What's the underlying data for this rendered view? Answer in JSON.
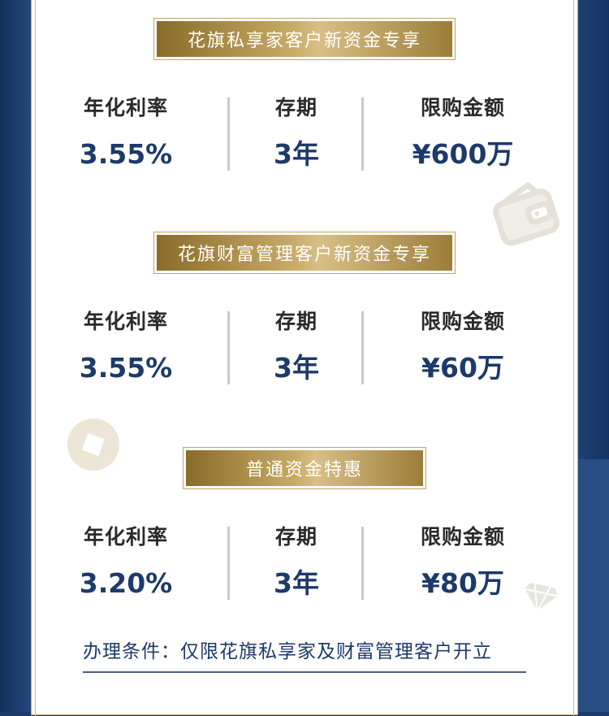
{
  "sections": [
    {
      "banner": "花旗私享家客户新资金专享",
      "rate_label": "年化利率",
      "rate_value": "3.55%",
      "term_label": "存期",
      "term_value": "3年",
      "limit_label": "限购金额",
      "limit_value": "¥600万"
    },
    {
      "banner": "花旗财富管理客户新资金专享",
      "rate_label": "年化利率",
      "rate_value": "3.55%",
      "term_label": "存期",
      "term_value": "3年",
      "limit_label": "限购金额",
      "limit_value": "¥60万"
    },
    {
      "banner": "普通资金特惠",
      "rate_label": "年化利率",
      "rate_value": "3.20%",
      "term_label": "存期",
      "term_value": "3年",
      "limit_label": "限购金额",
      "limit_value": "¥80万"
    }
  ],
  "condition": "办理条件：仅限花旗私享家及财富管理客户开立",
  "icons": [
    "wallet-icon",
    "diamond-coin-icon",
    "diamond-icon"
  ],
  "colors": {
    "navy": "#1c3a6a",
    "gold": "#c3a45f",
    "background": "#1d3a6a"
  }
}
